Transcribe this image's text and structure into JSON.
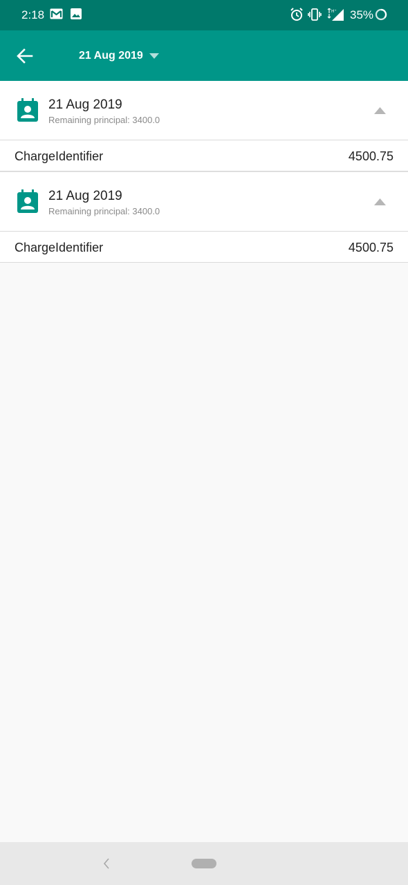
{
  "status_bar": {
    "time": "2:18",
    "battery": "35%",
    "icons": [
      "gmail-icon",
      "image-icon",
      "alarm-icon",
      "vibrate-icon",
      "signal-icon",
      "battery-icon"
    ]
  },
  "app_bar": {
    "back_icon": "arrow-left-icon",
    "selected_date": "21 Aug 2019",
    "dropdown_icon": "caret-down-icon"
  },
  "groups": [
    {
      "date": "21 Aug 2019",
      "remaining": "Remaining principal: 3400.0",
      "icon": "calendar-person-icon",
      "expanded": true,
      "charge": {
        "name": "ChargeIdentifier",
        "amount": "4500.75"
      }
    },
    {
      "date": "21 Aug 2019",
      "remaining": "Remaining principal: 3400.0",
      "icon": "calendar-person-icon",
      "expanded": true,
      "charge": {
        "name": "ChargeIdentifier",
        "amount": "4500.75"
      }
    }
  ],
  "colors": {
    "status_bar": "#00796b",
    "app_bar": "#009688",
    "accent": "#009688",
    "background": "#f9f9f9"
  }
}
